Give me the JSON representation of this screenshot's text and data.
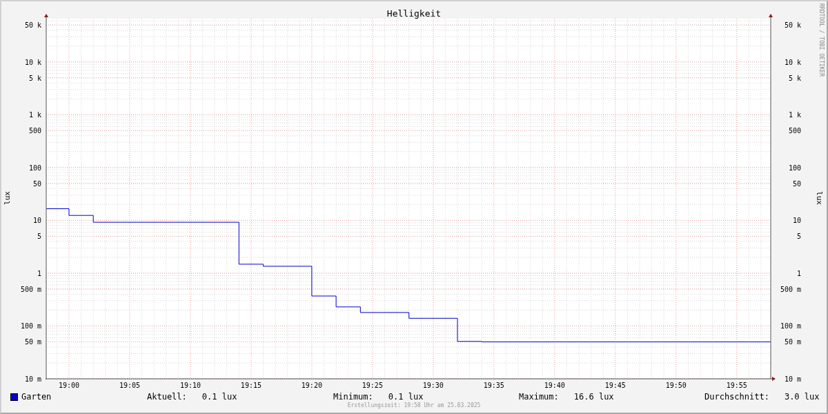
{
  "graph": {
    "title": "Helligkeit",
    "y_label": "lux",
    "right_y_label": "lux",
    "left_ticks": [
      "50 k",
      "10 k",
      "5 k",
      "1 k",
      "500",
      "100",
      "50",
      "10",
      "5",
      "1",
      "500 m",
      "100 m",
      "50 m",
      "10 m"
    ],
    "right_ticks": [
      "50 k",
      "10 k",
      "5 k",
      "1 k",
      "500",
      "100",
      "50",
      "10",
      "5",
      "1",
      "500 m",
      "100 m",
      "50 m",
      "10 m"
    ],
    "x_ticks": [
      "19:00",
      "19:05",
      "19:10",
      "19:15",
      "19:20",
      "19:25",
      "19:30",
      "19:35",
      "19:40",
      "19:45",
      "19:50",
      "19:55"
    ]
  },
  "credit": "RRDTOOL / TOBI OETIKER",
  "legend": {
    "series": "Garten",
    "stats": [
      {
        "label": "Aktuell:",
        "value": "0.1 lux"
      },
      {
        "label": "Minimum:",
        "value": "0.1 lux"
      },
      {
        "label": "Maximum:",
        "value": "16.6 lux"
      },
      {
        "label": "Durchschnitt:",
        "value": "3.0 lux"
      }
    ]
  },
  "footer": "Erstellungszeit: 19:58 Uhr am 25.03.2025"
}
